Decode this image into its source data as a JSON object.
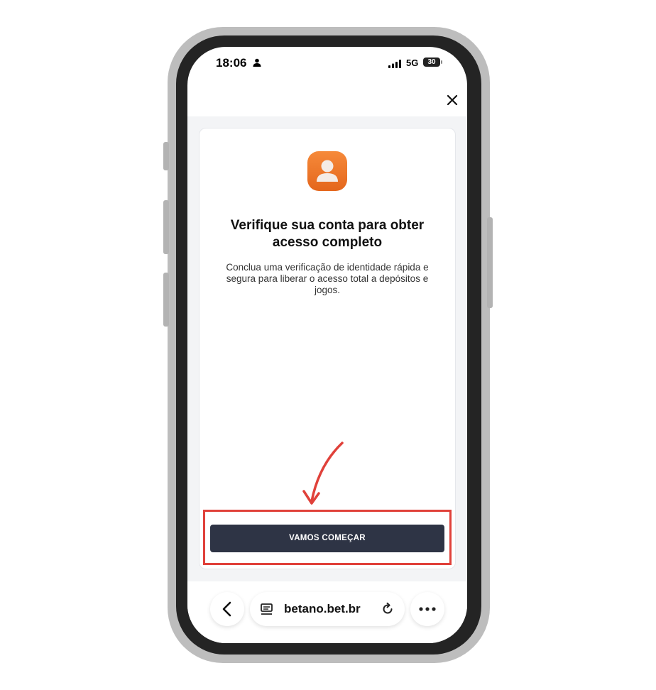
{
  "status_bar": {
    "time": "18:06",
    "network": "5G",
    "battery": "30"
  },
  "verification": {
    "heading": "Verifique sua conta para obter acesso completo",
    "description": "Conclua uma verificação de identidade rápida e segura para liberar o acesso total a depósitos e jogos.",
    "cta_label": "VAMOS COMEÇAR"
  },
  "browser": {
    "url": "betano.bet.br"
  },
  "icons": {
    "close": "close-icon",
    "account": "user-icon",
    "back": "chevron-left-icon",
    "tabs": "tab-list-icon",
    "reload": "reload-icon",
    "more": "more-icon"
  },
  "colors": {
    "accent_orange": "#f07a25",
    "button_bg": "#2e3445",
    "highlight": "#e0413a",
    "screen_bg": "#f3f4f6"
  }
}
